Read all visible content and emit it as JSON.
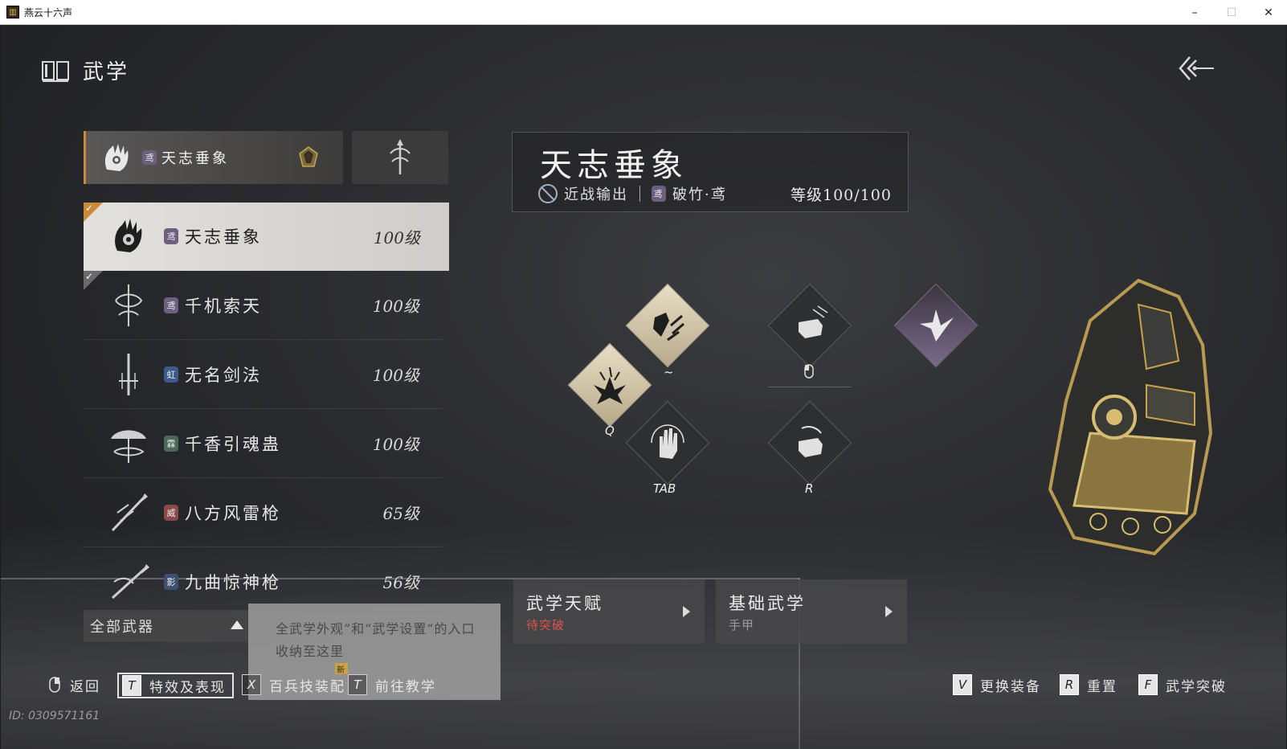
{
  "window": {
    "title": "燕云十六声",
    "minimize": "–",
    "maximize": "☐",
    "close": "✕"
  },
  "header": {
    "title": "武学",
    "book_icon": "book-icon",
    "back_icon": "back-arrow-icon"
  },
  "weapon_tabs": {
    "active": {
      "school_badge": "鸢",
      "name": "天志垂象",
      "icon": "gauntlet-hand-icon",
      "gem_icon": "gem-icon"
    },
    "other": {
      "icon": "spear-emblem-icon"
    }
  },
  "skills": [
    {
      "name": "天志垂象",
      "badge": "鸢",
      "badge_color": "#6c5f80",
      "level": "100级",
      "selected": true,
      "check": "✓"
    },
    {
      "name": "千机索天",
      "badge": "鸢",
      "badge_color": "#6c5f80",
      "level": "100级",
      "selected": false,
      "check": "✓"
    },
    {
      "name": "无名剑法",
      "badge": "虹",
      "badge_color": "#3d5a8a",
      "level": "100级",
      "selected": false
    },
    {
      "name": "千香引魂蛊",
      "badge": "霖",
      "badge_color": "#4a6a55",
      "level": "100级",
      "selected": false
    },
    {
      "name": "八方风雷枪",
      "badge": "威",
      "badge_color": "#8a4a4a",
      "level": "65级",
      "selected": false
    },
    {
      "name": "九曲惊神枪",
      "badge": "影",
      "badge_color": "#3d5070",
      "level": "56级",
      "selected": false
    }
  ],
  "filter": {
    "label": "全部武器"
  },
  "tooltip": {
    "text": "全武学外观”和“武学设置”的入口收纳至这里"
  },
  "info": {
    "name": "天志垂象",
    "role": "近战输出",
    "school_badge": "鸢",
    "school": "破竹·鸢",
    "level": "等级100/100"
  },
  "skill_keys": {
    "tilde": "~",
    "q": "Q",
    "tab": "TAB",
    "r": "R"
  },
  "cards": [
    {
      "title": "武学天赋",
      "sub": "待突破",
      "sub_color": "#d9534f"
    },
    {
      "title": "基础武学",
      "sub": "手甲",
      "sub_color": "#9a9a9a"
    }
  ],
  "bottom": {
    "back": "返回",
    "effects_key": "T",
    "effects": "特效及表现",
    "loadout_key": "X",
    "loadout": "百兵技装配",
    "new_tag": "新",
    "tutorial_key": "T",
    "tutorial": "前往教学",
    "swap_key": "V",
    "swap": "更换装备",
    "reset_key": "R",
    "reset": "重置",
    "breakthrough_key": "F",
    "breakthrough": "武学突破"
  },
  "id_text": "ID: 0309571161",
  "colors": {
    "accent": "#c98a3a",
    "gold": "#c9a34a",
    "warning": "#d9534f"
  }
}
